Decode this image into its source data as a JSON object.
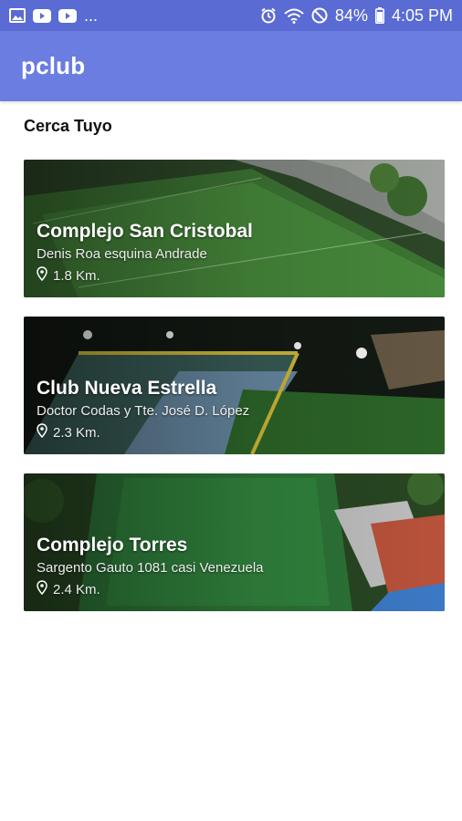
{
  "status_bar": {
    "left_icons": [
      "image-icon",
      "youtube-icon",
      "youtube-icon"
    ],
    "more": "...",
    "battery": "84%",
    "time": "4:05 PM"
  },
  "app_bar": {
    "title": "pclub"
  },
  "section": {
    "title": "Cerca Tuyo"
  },
  "venues": [
    {
      "name": "Complejo San Cristobal",
      "address": "Denis Roa esquina Andrade",
      "distance": "1.8 Km."
    },
    {
      "name": "Club Nueva Estrella",
      "address": "Doctor Codas y Tte. José D. López",
      "distance": "2.3 Km."
    },
    {
      "name": "Complejo Torres",
      "address": "Sargento Gauto 1081 casi Venezuela",
      "distance": "2.4 Km."
    }
  ],
  "colors": {
    "status_bar": "#5a6bd4",
    "app_bar": "#6b7de0"
  }
}
